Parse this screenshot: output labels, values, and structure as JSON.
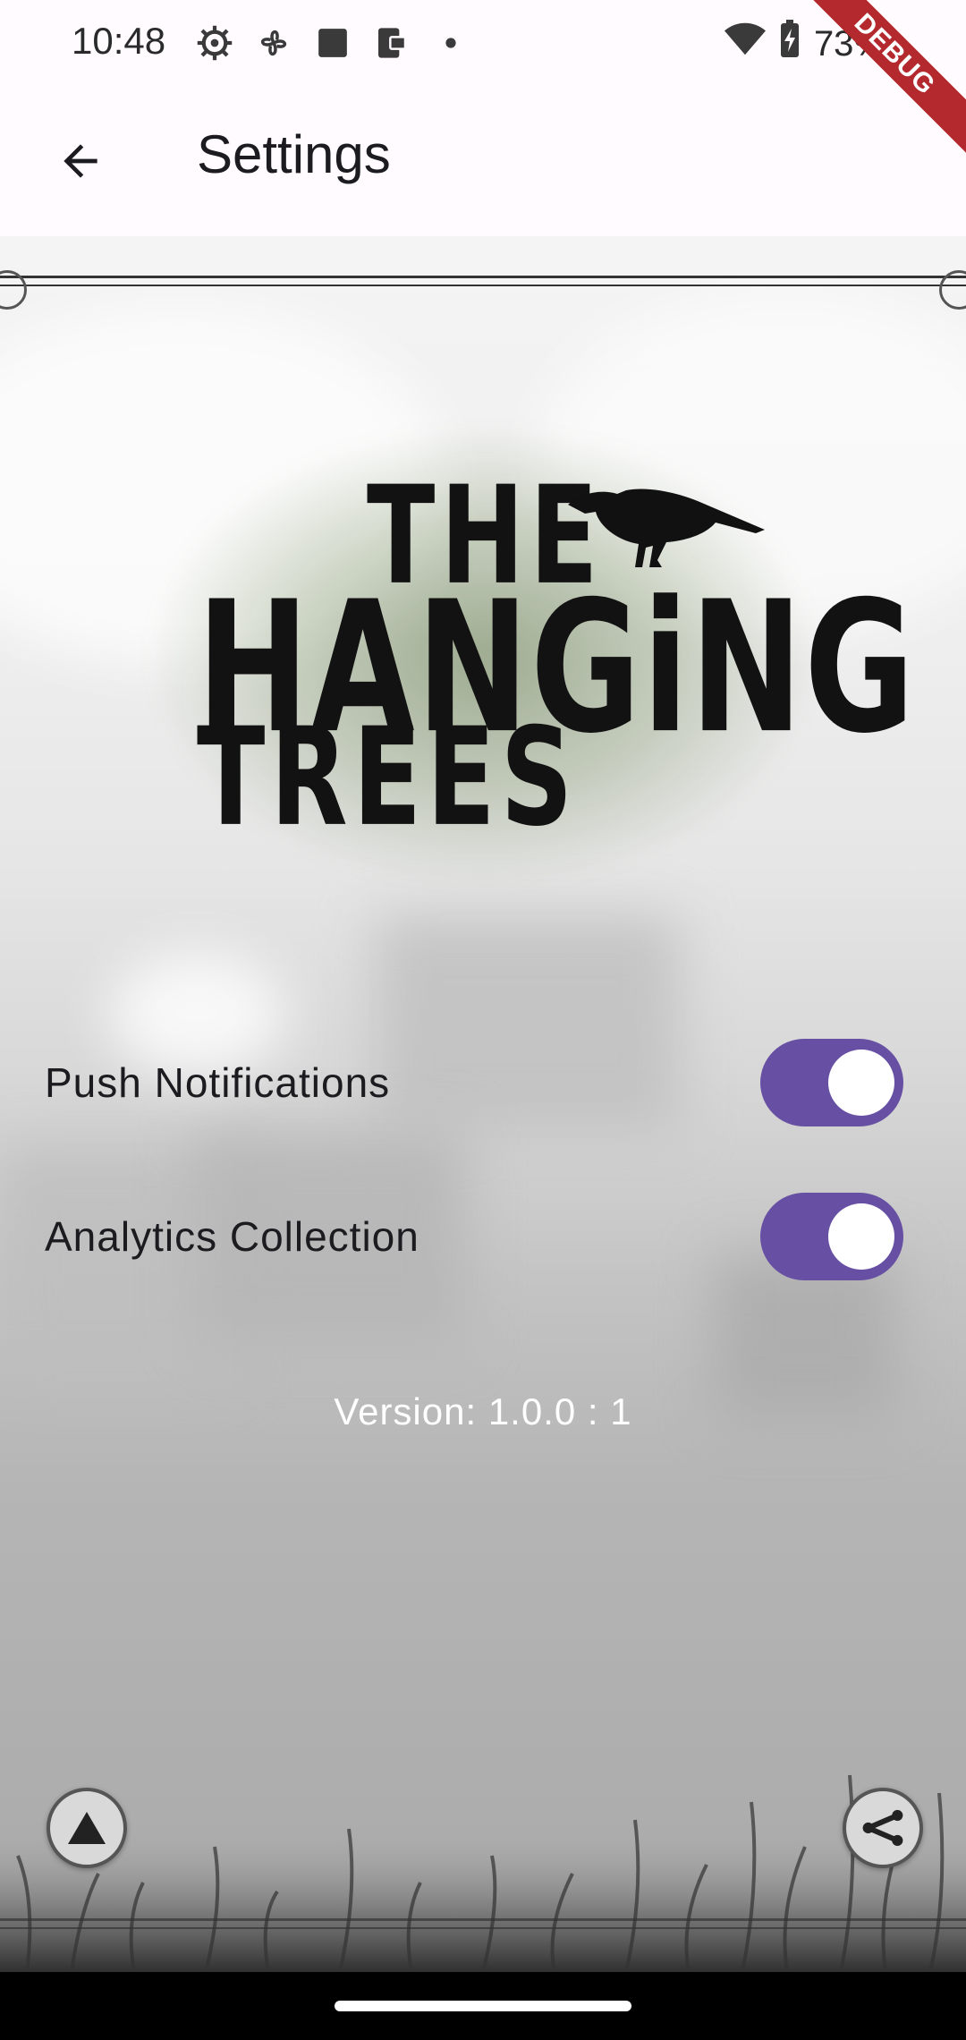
{
  "status_bar": {
    "time": "10:48",
    "battery": "73%",
    "icons": [
      "settings-gear-icon",
      "fan-icon",
      "square-icon",
      "device-icon",
      "dot-icon",
      "wifi-icon",
      "battery-charging-icon"
    ]
  },
  "debug_banner": "DEBUG",
  "app_bar": {
    "back_icon": "arrow-back-icon",
    "title": "Settings"
  },
  "logo": {
    "line1": "THE",
    "line2": "HANGiNG",
    "line3": "TREES"
  },
  "settings": {
    "push_notifications": {
      "label": "Push Notifications",
      "enabled": true
    },
    "analytics_collection": {
      "label": "Analytics Collection",
      "enabled": true
    }
  },
  "version": "Version: 1.0.0 : 1",
  "bottom_buttons": {
    "left_icon": "triangle-up-icon",
    "right_icon": "share-icon"
  },
  "colors": {
    "toggle_active": "#6750a4",
    "app_bar_bg": "#fffbfe",
    "debug_ribbon": "#b3292e"
  }
}
